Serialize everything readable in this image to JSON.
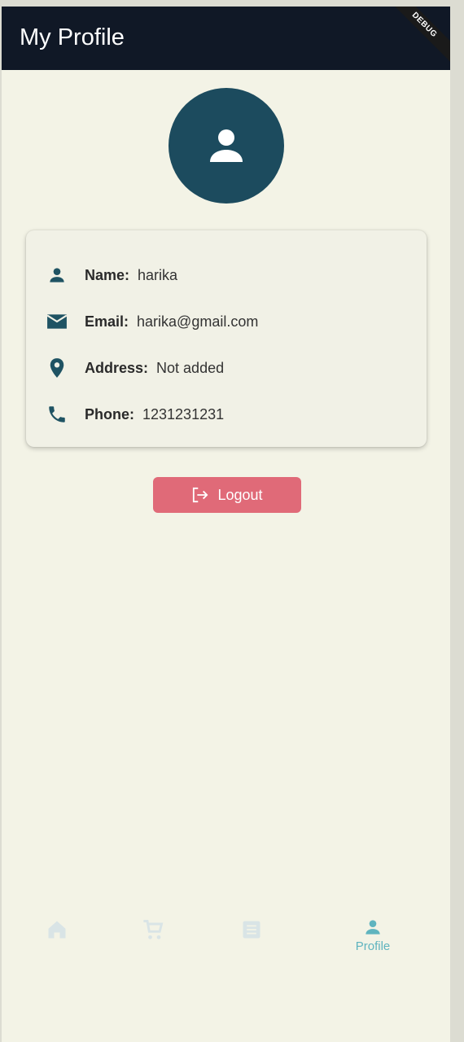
{
  "appbar": {
    "title": "My Profile",
    "debug_banner": "DEBUG"
  },
  "profile": {
    "fields": [
      {
        "icon": "person-icon",
        "label": "Name:",
        "value": "harika"
      },
      {
        "icon": "mail-icon",
        "label": "Email:",
        "value": "harika@gmail.com"
      },
      {
        "icon": "location-pin-icon",
        "label": "Address:",
        "value": "Not added"
      },
      {
        "icon": "phone-icon",
        "label": "Phone:",
        "value": "1231231231"
      }
    ]
  },
  "actions": {
    "logout_label": "Logout"
  },
  "bottom_nav": {
    "items": [
      {
        "icon": "home-icon",
        "label": ""
      },
      {
        "icon": "cart-icon",
        "label": ""
      },
      {
        "icon": "list-icon",
        "label": ""
      },
      {
        "icon": "person-icon",
        "label": "Profile"
      }
    ],
    "active_index": 3
  },
  "colors": {
    "appbar": "#101826",
    "avatar": "#1c4b5e",
    "icon": "#1f5363",
    "logout": "#e06a78",
    "nav_active": "#5fb4bf",
    "nav_inactive": "#d9e4e6"
  }
}
